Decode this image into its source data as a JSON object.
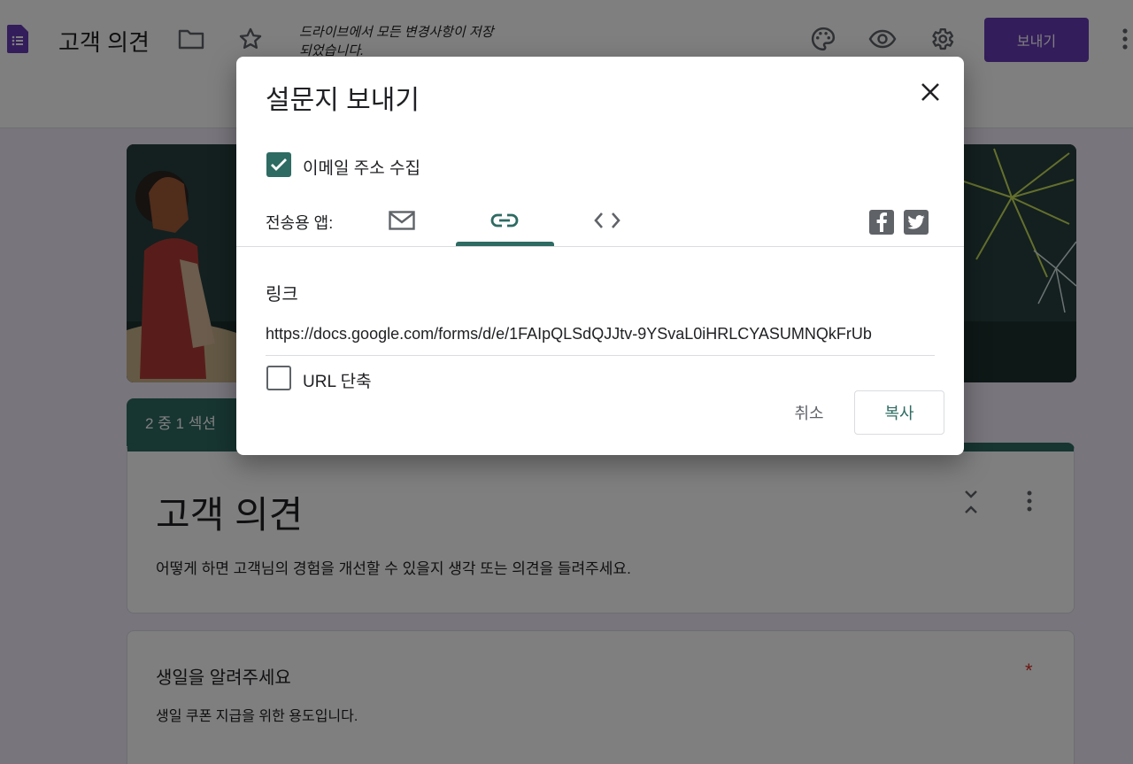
{
  "header": {
    "app_icon": "google-forms-icon",
    "title": "고객 의견",
    "save_status": "드라이브에서 모든 변경사항이 저장되었습니다.",
    "icons": [
      "folder-icon",
      "star-icon",
      "palette-icon",
      "preview-eye-icon",
      "settings-gear-icon",
      "more-vert-icon"
    ],
    "send_label": "보내기"
  },
  "form": {
    "section_label": "2 중 1 섹션",
    "title": "고객 의견",
    "description": "어떻게 하면 고객님의 경험을 개선할 수 있을지 생각 또는 의견을 들려주세요.",
    "question": {
      "title": "생일을 알려주세요",
      "description": "생일 쿠폰 지급을 위한 용도입니다.",
      "required_mark": "*"
    }
  },
  "dialog": {
    "title": "설문지 보내기",
    "collect_email": {
      "label": "이메일 주소 수집",
      "checked": true
    },
    "send_via_label": "전송용 앱:",
    "tabs": [
      {
        "name": "email",
        "icon": "email-icon",
        "selected": false
      },
      {
        "name": "link",
        "icon": "link-icon",
        "selected": true
      },
      {
        "name": "embed",
        "icon": "embed-code-icon",
        "selected": false
      }
    ],
    "social": [
      "facebook-icon",
      "twitter-icon"
    ],
    "link_heading": "링크",
    "link_value": "https://docs.google.com/forms/d/e/1FAIpQLSdQJJtv-9YSvaL0iHRLCYASUMNQkFrUb",
    "shorten_url": {
      "label": "URL 단축",
      "checked": false
    },
    "cancel_label": "취소",
    "copy_label": "복사"
  },
  "colors": {
    "accent": "#2e6b62",
    "brand": "#673ab7",
    "required": "#d93025"
  }
}
